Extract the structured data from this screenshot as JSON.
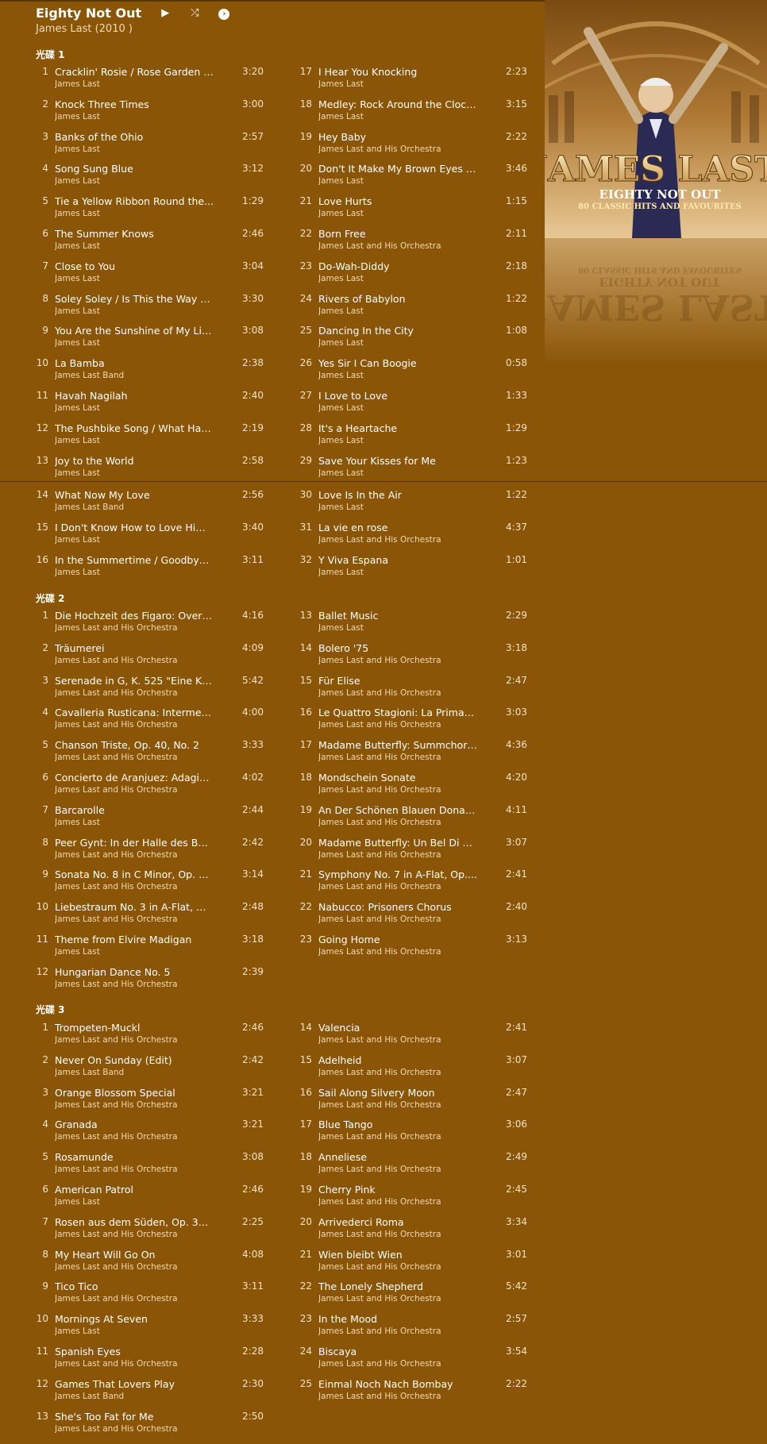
{
  "album": {
    "title": "Eighty Not Out",
    "subtitle": "James Last (2010 )",
    "controls": {
      "play": "▶",
      "shuffle": "⤮",
      "more": "›"
    }
  },
  "art": {
    "big": "JAMES LAST",
    "line1": "EIGHTY NOT OUT",
    "line2": "80 CLASSIC HITS AND FAVOURITES"
  },
  "disc_labels": [
    "光碟 1",
    "光碟 2",
    "光碟 3"
  ],
  "discs": [
    {
      "left": [
        {
          "n": "1",
          "name": "Cracklin' Rosie / Rose Garden (L...",
          "artist": "James Last",
          "dur": "3:20"
        },
        {
          "n": "2",
          "name": "Knock Three Times",
          "artist": "James Last",
          "dur": "3:00"
        },
        {
          "n": "3",
          "name": "Banks of the Ohio",
          "artist": "James Last",
          "dur": "2:57"
        },
        {
          "n": "4",
          "name": "Song Sung Blue",
          "artist": "James Last",
          "dur": "3:12"
        },
        {
          "n": "5",
          "name": "Tie a Yellow Ribbon Round the...",
          "artist": "James Last",
          "dur": "1:29"
        },
        {
          "n": "6",
          "name": "The Summer Knows",
          "artist": "James Last",
          "dur": "2:46"
        },
        {
          "n": "7",
          "name": "Close to You",
          "artist": "James Last",
          "dur": "3:04"
        },
        {
          "n": "8",
          "name": "Soley Soley / Is This the Way to...",
          "artist": "James Last",
          "dur": "3:30"
        },
        {
          "n": "9",
          "name": "You Are the Sunshine of My Lif...",
          "artist": "James Last",
          "dur": "3:08"
        },
        {
          "n": "10",
          "name": "La Bamba",
          "artist": "James Last Band",
          "dur": "2:38"
        },
        {
          "n": "11",
          "name": "Havah Nagilah",
          "artist": "James Last",
          "dur": "2:40"
        },
        {
          "n": "12",
          "name": "The Pushbike Song / What Hav...",
          "artist": "James Last",
          "dur": "2:19"
        },
        {
          "n": "13",
          "name": "Joy to the World",
          "artist": "James Last",
          "dur": "2:58"
        },
        {
          "n": "14",
          "name": "What Now My Love",
          "artist": "James Last Band",
          "dur": "2:56"
        },
        {
          "n": "15",
          "name": "I Don't Know How to Love Him...",
          "artist": "James Last",
          "dur": "3:40"
        },
        {
          "n": "16",
          "name": "In the Summertime / Goodbye...",
          "artist": "James Last",
          "dur": "3:11"
        }
      ],
      "right": [
        {
          "n": "17",
          "name": "I Hear You Knocking",
          "artist": "James Last",
          "dur": "2:23"
        },
        {
          "n": "18",
          "name": "Medley: Rock Around the Clock...",
          "artist": "James Last",
          "dur": "3:15"
        },
        {
          "n": "19",
          "name": "Hey Baby",
          "artist": "James Last and His Orchestra",
          "dur": "2:22"
        },
        {
          "n": "20",
          "name": "Don't It Make My Brown Eyes Bl...",
          "artist": "James Last",
          "dur": "3:46"
        },
        {
          "n": "21",
          "name": "Love Hurts",
          "artist": "James Last",
          "dur": "1:15"
        },
        {
          "n": "22",
          "name": "Born Free",
          "artist": "James Last and His Orchestra",
          "dur": "2:11"
        },
        {
          "n": "23",
          "name": "Do-Wah-Diddy",
          "artist": "James Last",
          "dur": "2:18"
        },
        {
          "n": "24",
          "name": "Rivers of Babylon",
          "artist": "James Last",
          "dur": "1:22"
        },
        {
          "n": "25",
          "name": "Dancing In the City",
          "artist": "James Last",
          "dur": "1:08"
        },
        {
          "n": "26",
          "name": "Yes Sir I Can Boogie",
          "artist": "James Last",
          "dur": "0:58"
        },
        {
          "n": "27",
          "name": "I Love to Love",
          "artist": "James Last",
          "dur": "1:33"
        },
        {
          "n": "28",
          "name": "It's a Heartache",
          "artist": "James Last",
          "dur": "1:29"
        },
        {
          "n": "29",
          "name": "Save Your Kisses for Me",
          "artist": "James Last",
          "dur": "1:23"
        },
        {
          "n": "30",
          "name": "Love Is In the Air",
          "artist": "James Last",
          "dur": "1:22"
        },
        {
          "n": "31",
          "name": "La vie en rose",
          "artist": "James Last and His Orchestra",
          "dur": "4:37"
        },
        {
          "n": "32",
          "name": "Y Viva Espana",
          "artist": "James Last",
          "dur": "1:01"
        }
      ]
    },
    {
      "left": [
        {
          "n": "1",
          "name": "Die Hochzeit des Figaro: Overtu...",
          "artist": "James Last and His Orchestra",
          "dur": "4:16"
        },
        {
          "n": "2",
          "name": "Träumerei",
          "artist": "James Last and His Orchestra",
          "dur": "4:09"
        },
        {
          "n": "3",
          "name": "Serenade in G, K. 525 \"Eine Klei...",
          "artist": "James Last and His Orchestra",
          "dur": "5:42"
        },
        {
          "n": "4",
          "name": "Cavalleria Rusticana: Intermezz...",
          "artist": "James Last and His Orchestra",
          "dur": "4:00"
        },
        {
          "n": "5",
          "name": "Chanson Triste, Op. 40, No. 2",
          "artist": "James Last and His Orchestra",
          "dur": "3:33"
        },
        {
          "n": "6",
          "name": "Concierto de Aranjuez: Adagio (...",
          "artist": "James Last and His Orchestra",
          "dur": "4:02"
        },
        {
          "n": "7",
          "name": "Barcarolle",
          "artist": "James Last",
          "dur": "2:44"
        },
        {
          "n": "8",
          "name": "Peer Gynt: In der Halle des Berg...",
          "artist": "James Last and His Orchestra",
          "dur": "2:42"
        },
        {
          "n": "9",
          "name": "Sonata No. 8 in C Minor, Op. 13...",
          "artist": "James Last and His Orchestra",
          "dur": "3:14"
        },
        {
          "n": "10",
          "name": "Liebestraum No. 3 in A-Flat, Op...",
          "artist": "James Last and His Orchestra",
          "dur": "2:48"
        },
        {
          "n": "11",
          "name": "Theme from Elvire Madigan",
          "artist": "James Last",
          "dur": "3:18"
        },
        {
          "n": "12",
          "name": "Hungarian Dance No. 5",
          "artist": "James Last and His Orchestra",
          "dur": "2:39"
        }
      ],
      "right": [
        {
          "n": "13",
          "name": "Ballet Music",
          "artist": "James Last",
          "dur": "2:29"
        },
        {
          "n": "14",
          "name": "Bolero '75",
          "artist": "James Last and His Orchestra",
          "dur": "3:18"
        },
        {
          "n": "15",
          "name": "Für Elise",
          "artist": "James Last and His Orchestra",
          "dur": "2:47"
        },
        {
          "n": "16",
          "name": "Le Quattro Stagioni: La Primave...",
          "artist": "James Last and His Orchestra",
          "dur": "3:03"
        },
        {
          "n": "17",
          "name": "Madame Butterfly: Summchor (...",
          "artist": "James Last and His Orchestra",
          "dur": "4:36"
        },
        {
          "n": "18",
          "name": "Mondschein Sonate",
          "artist": "James Last and His Orchestra",
          "dur": "4:20"
        },
        {
          "n": "19",
          "name": "An Der Schönen Blauen Donau,...",
          "artist": "James Last and His Orchestra",
          "dur": "4:11"
        },
        {
          "n": "20",
          "name": "Madame Butterfly: Un Bel Di Ve...",
          "artist": "James Last and His Orchestra",
          "dur": "3:07"
        },
        {
          "n": "21",
          "name": "Symphony No. 7 in A-Flat, Op....",
          "artist": "James Last and His Orchestra",
          "dur": "2:41"
        },
        {
          "n": "22",
          "name": "Nabucco: Prisoners Chorus",
          "artist": "James Last and His Orchestra",
          "dur": "2:40"
        },
        {
          "n": "23",
          "name": "Going Home",
          "artist": "James Last and His Orchestra",
          "dur": "3:13"
        }
      ]
    },
    {
      "left": [
        {
          "n": "1",
          "name": "Trompeten-Muckl",
          "artist": "James Last and His Orchestra",
          "dur": "2:46"
        },
        {
          "n": "2",
          "name": "Never On Sunday (Edit)",
          "artist": "James Last Band",
          "dur": "2:42"
        },
        {
          "n": "3",
          "name": "Orange Blossom Special",
          "artist": "James Last and His Orchestra",
          "dur": "3:21"
        },
        {
          "n": "4",
          "name": "Granada",
          "artist": "James Last and His Orchestra",
          "dur": "3:21"
        },
        {
          "n": "5",
          "name": "Rosamunde",
          "artist": "James Last and His Orchestra",
          "dur": "3:08"
        },
        {
          "n": "6",
          "name": "American Patrol",
          "artist": "James Last",
          "dur": "2:46"
        },
        {
          "n": "7",
          "name": "Rosen aus dem Süden, Op. 388...",
          "artist": "James Last and His Orchestra",
          "dur": "2:25"
        },
        {
          "n": "8",
          "name": "My Heart Will Go On",
          "artist": "James Last and His Orchestra",
          "dur": "4:08"
        },
        {
          "n": "9",
          "name": "Tico Tico",
          "artist": "James Last and His Orchestra",
          "dur": "3:11"
        },
        {
          "n": "10",
          "name": "Mornings At Seven",
          "artist": "James Last",
          "dur": "3:33"
        },
        {
          "n": "11",
          "name": "Spanish Eyes",
          "artist": "James Last and His Orchestra",
          "dur": "2:28"
        },
        {
          "n": "12",
          "name": "Games That Lovers Play",
          "artist": "James Last Band",
          "dur": "2:30"
        },
        {
          "n": "13",
          "name": "She's Too Fat for Me",
          "artist": "James Last and His Orchestra",
          "dur": "2:50"
        }
      ],
      "right": [
        {
          "n": "14",
          "name": "Valencia",
          "artist": "James Last and His Orchestra",
          "dur": "2:41"
        },
        {
          "n": "15",
          "name": "Adelheid",
          "artist": "James Last and His Orchestra",
          "dur": "3:07"
        },
        {
          "n": "16",
          "name": "Sail Along Silvery Moon",
          "artist": "James Last and His Orchestra",
          "dur": "2:47"
        },
        {
          "n": "17",
          "name": "Blue Tango",
          "artist": "James Last and His Orchestra",
          "dur": "3:06"
        },
        {
          "n": "18",
          "name": "Anneliese",
          "artist": "James Last and His Orchestra",
          "dur": "2:49"
        },
        {
          "n": "19",
          "name": "Cherry Pink",
          "artist": "James Last and His Orchestra",
          "dur": "2:45"
        },
        {
          "n": "20",
          "name": "Arrivederci Roma",
          "artist": "James Last and His Orchestra",
          "dur": "3:34"
        },
        {
          "n": "21",
          "name": "Wien bleibt Wien",
          "artist": "James Last and His Orchestra",
          "dur": "3:01"
        },
        {
          "n": "22",
          "name": "The Lonely Shepherd",
          "artist": "James Last and His Orchestra",
          "dur": "5:42"
        },
        {
          "n": "23",
          "name": "In the Mood",
          "artist": "James Last and His Orchestra",
          "dur": "2:57"
        },
        {
          "n": "24",
          "name": "Biscaya",
          "artist": "James Last and His Orchestra",
          "dur": "3:54"
        },
        {
          "n": "25",
          "name": "Einmal Noch Nach Bombay",
          "artist": "James Last and His Orchestra",
          "dur": "2:22"
        }
      ]
    }
  ]
}
